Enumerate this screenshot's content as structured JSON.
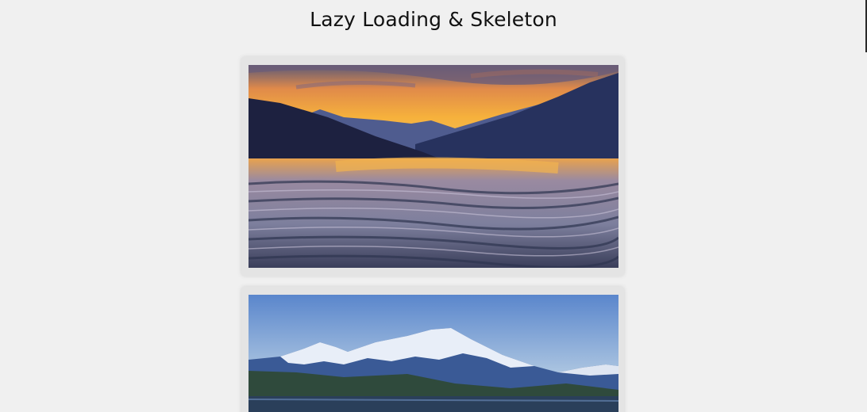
{
  "page": {
    "title": "Lazy Loading & Skeleton"
  },
  "images": [
    {
      "alt": "sunset lake landscape",
      "status": "loaded"
    },
    {
      "alt": "snowy mountain landscape",
      "status": "loaded"
    }
  ],
  "colors": {
    "background": "#f0f0f0",
    "card": "#e4e4e4",
    "title": "#111111"
  }
}
